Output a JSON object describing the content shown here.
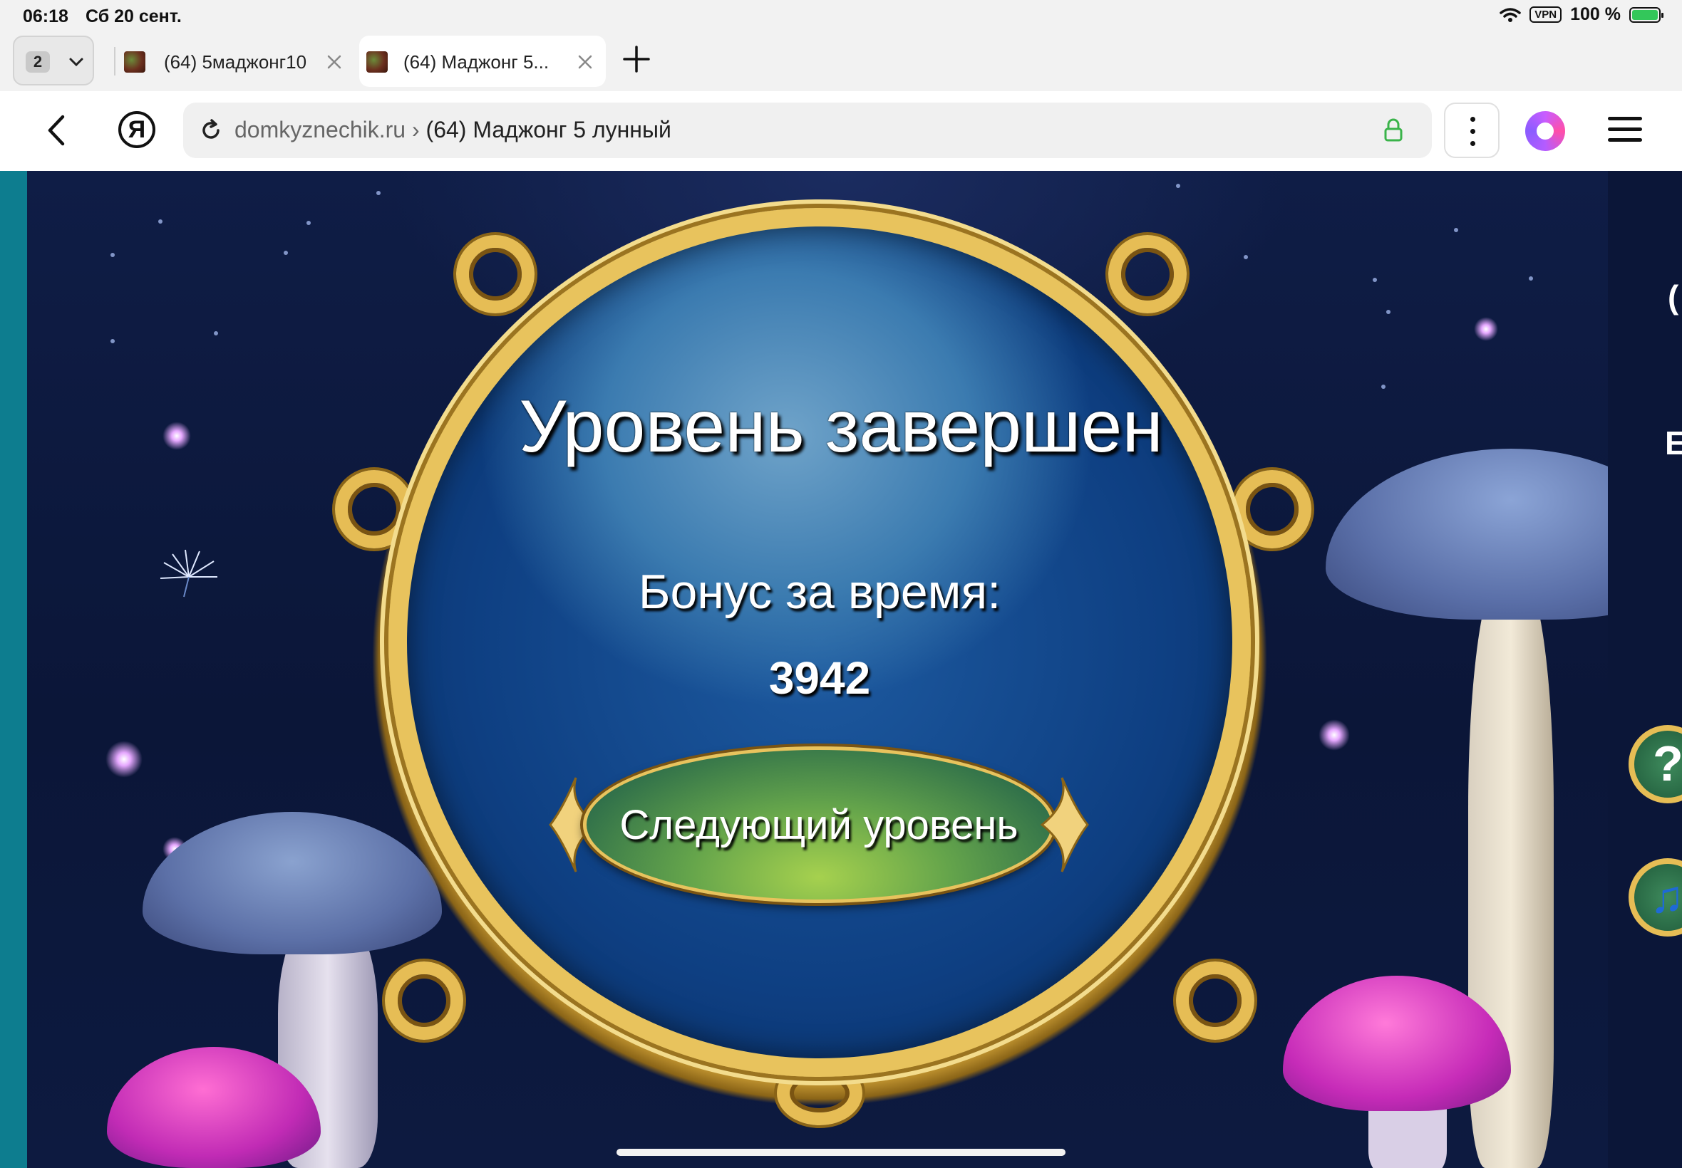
{
  "status_bar": {
    "time": "06:18",
    "date": "Сб 20 сент.",
    "vpn": "VPN",
    "battery": "100 %",
    "battery_color": "#33c75a"
  },
  "tabs": {
    "count": "2",
    "items": [
      {
        "title": "(64) 5маджонг10",
        "active": false
      },
      {
        "title": "(64) Маджонг 5...",
        "active": true
      }
    ]
  },
  "address_bar": {
    "host": "domkyznechik.ru",
    "separator": "›",
    "page_title": "(64) Маджонг 5 лунный",
    "yandex_letter": "Я"
  },
  "game": {
    "title": "Уровень завершен",
    "bonus_label": "Бонус за время:",
    "bonus_value": "3942",
    "next_button": "Следующий уровень",
    "help_glyph": "?",
    "music_glyph": "♫",
    "right_panel_glyphs": [
      "(",
      "E"
    ],
    "colors": {
      "disc_blue": "#0e3f82",
      "frame_gold": "#e8c35d",
      "button_green": "#64a44b",
      "left_strip": "#0d7d8f"
    }
  }
}
